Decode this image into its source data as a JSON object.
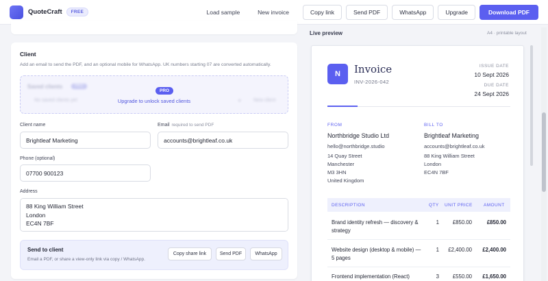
{
  "header": {
    "brand": "QuoteCraft",
    "plan_badge": "FREE",
    "nav": {
      "load_sample": "Load sample",
      "new_invoice": "New invoice"
    },
    "buttons": {
      "copy_link": "Copy link",
      "send_pdf": "Send PDF",
      "whatsapp": "WhatsApp",
      "upgrade": "Upgrade",
      "download_pdf": "Download PDF"
    }
  },
  "client_section": {
    "title": "Client",
    "description": "Add an email to send the PDF, and an optional mobile for WhatsApp. UK numbers starting 07 are converted automatically.",
    "saved_clients": {
      "title": "Saved clients",
      "pro_badge": "PRO",
      "empty_text": "No saved clients yet",
      "new_client": "New client",
      "upgrade_badge": "PRO",
      "upgrade_link": "Upgrade to unlock saved clients"
    },
    "fields": {
      "client_name": {
        "label": "Client name",
        "value": "Brightleaf Marketing"
      },
      "email": {
        "label": "Email",
        "hint": "required to send PDF",
        "value": "accounts@brightleaf.co.uk"
      },
      "phone": {
        "label": "Phone (optional)",
        "value": "07700 900123"
      },
      "address": {
        "label": "Address",
        "value": "88 King William Street\nLondon\nEC4N 7BF"
      }
    },
    "send": {
      "title": "Send to client",
      "description": "Email a PDF, or share a view-only link via copy / WhatsApp.",
      "copy_share_link": "Copy share link",
      "send_pdf": "Send PDF",
      "whatsapp": "WhatsApp"
    }
  },
  "preview": {
    "label": "Live preview",
    "layout_note": "A4 · printable layout",
    "invoice": {
      "logo_letter": "N",
      "title": "Invoice",
      "number": "INV-2026-042",
      "issue_date_label": "ISSUE DATE",
      "issue_date": "10 Sept 2026",
      "due_date_label": "DUE DATE",
      "due_date": "24 Sept 2026",
      "from": {
        "label": "FROM",
        "name": "Northbridge Studio Ltd",
        "email": "hello@northbridge.studio",
        "lines": [
          "14 Quay Street",
          "Manchester",
          "M3 3HN",
          "United Kingdom"
        ]
      },
      "bill_to": {
        "label": "BILL TO",
        "name": "Brightleaf Marketing",
        "email": "accounts@brightleaf.co.uk",
        "lines": [
          "88 King William Street",
          "London",
          "EC4N 7BF"
        ]
      },
      "columns": {
        "description": "DESCRIPTION",
        "qty": "QTY",
        "unit_price": "UNIT PRICE",
        "amount": "AMOUNT"
      },
      "items": [
        {
          "description": "Brand identity refresh — discovery & strategy",
          "qty": "1",
          "unit_price": "£850.00",
          "amount": "£850.00"
        },
        {
          "description": "Website design (desktop & mobile) — 5 pages",
          "qty": "1",
          "unit_price": "£2,400.00",
          "amount": "£2,400.00"
        },
        {
          "description": "Frontend implementation (React)",
          "qty": "3",
          "unit_price": "£550.00",
          "amount": "£1,650.00"
        }
      ]
    }
  }
}
